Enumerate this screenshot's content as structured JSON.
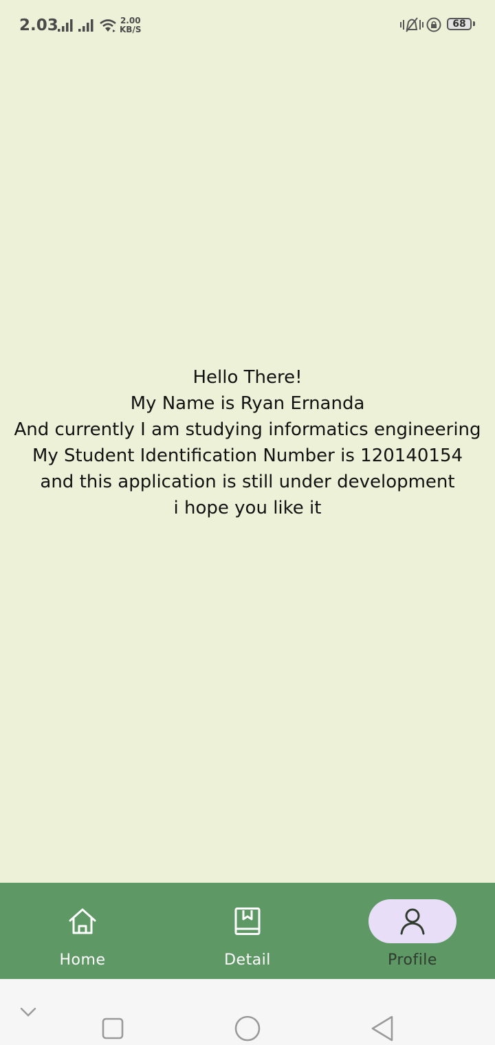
{
  "status_bar": {
    "time": "2.03",
    "speed_value": "2.00",
    "speed_unit": "KB/S",
    "battery": "68",
    "icons": [
      "signal-icon",
      "signal-icon",
      "wifi-icon",
      "vibrate-icon",
      "rotation-lock-icon",
      "battery-icon"
    ]
  },
  "profile": {
    "lines": [
      "Hello There!",
      "My Name is Ryan Ernanda",
      "And currently I am studying informatics engineering",
      "My Student Identification Number is 120140154",
      "and this application is still under development",
      "i hope you like it"
    ]
  },
  "bottom_nav": {
    "items": [
      {
        "label": "Home",
        "icon": "home-icon",
        "active": false
      },
      {
        "label": "Detail",
        "icon": "book-icon",
        "active": false
      },
      {
        "label": "Profile",
        "icon": "person-icon",
        "active": true
      }
    ],
    "colors": {
      "background": "#5e9965",
      "active_pill": "#e8def8"
    }
  },
  "system_nav": {
    "buttons": [
      "collapse-icon",
      "recents-icon",
      "home-circle-icon",
      "back-icon"
    ]
  },
  "colors": {
    "page_background": "#edf1d7"
  }
}
